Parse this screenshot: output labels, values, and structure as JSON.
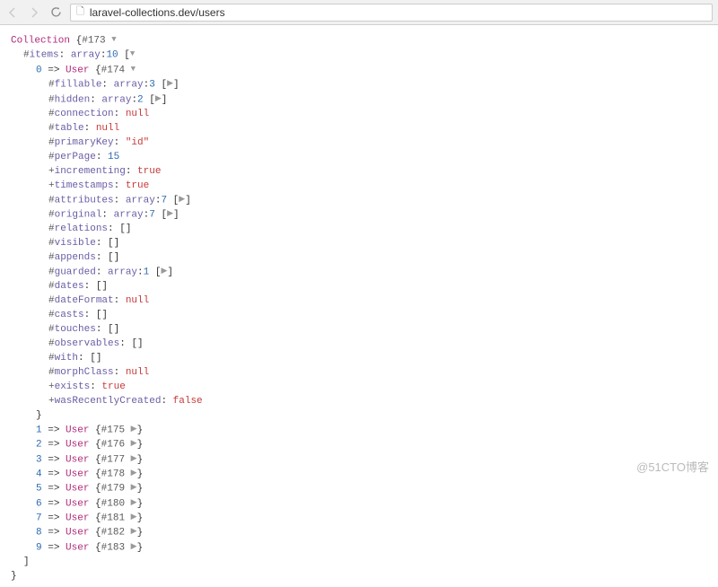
{
  "url": "laravel-collections.dev/users",
  "collection": {
    "class": "Collection",
    "ref": "#173",
    "items": {
      "key": "items",
      "type": "array",
      "count": 10,
      "prefix": "#"
    }
  },
  "user0": {
    "index": 0,
    "class": "User",
    "ref": "#174",
    "props": {
      "fillable": {
        "prefix": "#",
        "type": "array",
        "count": 3
      },
      "hidden": {
        "prefix": "#",
        "type": "array",
        "count": 2
      },
      "connection": {
        "prefix": "#",
        "value": "null",
        "kind": "nul"
      },
      "table": {
        "prefix": "#",
        "value": "null",
        "kind": "nul"
      },
      "primaryKey": {
        "prefix": "#",
        "value": "\"id\"",
        "kind": "str"
      },
      "perPage": {
        "prefix": "#",
        "value": "15",
        "kind": "num"
      },
      "incrementing": {
        "prefix": "+",
        "value": "true",
        "kind": "bool"
      },
      "timestamps": {
        "prefix": "+",
        "value": "true",
        "kind": "bool"
      },
      "attributes": {
        "prefix": "#",
        "type": "array",
        "count": 7
      },
      "original": {
        "prefix": "#",
        "type": "array",
        "count": 7
      },
      "relations": {
        "prefix": "#",
        "value": "[]",
        "kind": "delim"
      },
      "visible": {
        "prefix": "#",
        "value": "[]",
        "kind": "delim"
      },
      "appends": {
        "prefix": "#",
        "value": "[]",
        "kind": "delim"
      },
      "guarded": {
        "prefix": "#",
        "type": "array",
        "count": 1
      },
      "dates": {
        "prefix": "#",
        "value": "[]",
        "kind": "delim"
      },
      "dateFormat": {
        "prefix": "#",
        "value": "null",
        "kind": "nul"
      },
      "casts": {
        "prefix": "#",
        "value": "[]",
        "kind": "delim"
      },
      "touches": {
        "prefix": "#",
        "value": "[]",
        "kind": "delim"
      },
      "observables": {
        "prefix": "#",
        "value": "[]",
        "kind": "delim"
      },
      "with": {
        "prefix": "#",
        "value": "[]",
        "kind": "delim"
      },
      "morphClass": {
        "prefix": "#",
        "value": "null",
        "kind": "nul"
      },
      "exists": {
        "prefix": "+",
        "value": "true",
        "kind": "bool"
      },
      "wasRecentlyCreated": {
        "prefix": "+",
        "value": "false",
        "kind": "bool"
      }
    }
  },
  "users": [
    {
      "index": 1,
      "class": "User",
      "ref": "#175"
    },
    {
      "index": 2,
      "class": "User",
      "ref": "#176"
    },
    {
      "index": 3,
      "class": "User",
      "ref": "#177"
    },
    {
      "index": 4,
      "class": "User",
      "ref": "#178"
    },
    {
      "index": 5,
      "class": "User",
      "ref": "#179"
    },
    {
      "index": 6,
      "class": "User",
      "ref": "#180"
    },
    {
      "index": 7,
      "class": "User",
      "ref": "#181"
    },
    {
      "index": 8,
      "class": "User",
      "ref": "#182"
    },
    {
      "index": 9,
      "class": "User",
      "ref": "#183"
    }
  ],
  "watermark": "@51CTO博客"
}
